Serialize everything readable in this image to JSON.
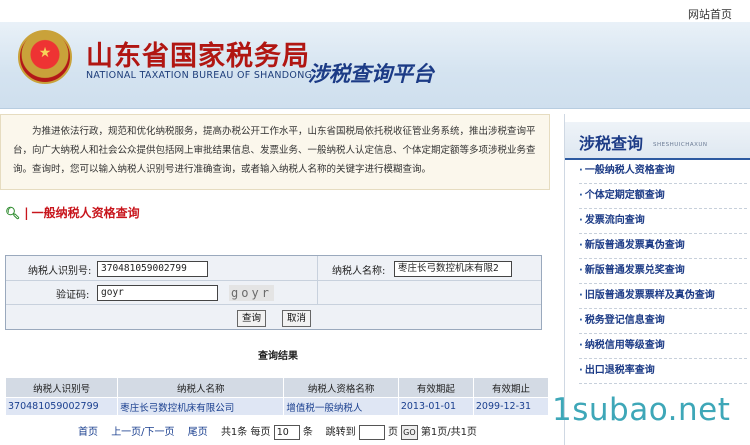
{
  "header": {
    "home_link": "网站首页",
    "title_cn": "山东省国家税务局",
    "title_en": "NATIONAL TAXATION BUREAU OF SHANDONG",
    "platform": "涉税查询平台"
  },
  "intro": {
    "text": "为推进依法行政，规范和优化纳税服务，提高办税公开工作水平，山东省国税局依托税收征管业务系统，推出涉税查询平台，向广大纳税人和社会公众提供包括网上审批结果信息、发票业务、一般纳税人认定信息、个体定期定额等多项涉税业务查询。查询时，您可以输入纳税人识别号进行准确查询，或者输入纳税人名称的关键字进行模糊查询。"
  },
  "section": {
    "title": "一般纳税人资格查询"
  },
  "form": {
    "taxpayer_id_label": "纳税人识别号:",
    "taxpayer_id_value": "370481059002799",
    "taxpayer_name_label": "纳税人名称:",
    "taxpayer_name_value": "枣庄长弓数控机床有限2",
    "captcha_label": "验证码:",
    "captcha_value": "goyr",
    "captcha_image_text": "goyr",
    "query_button": "查询",
    "cancel_button": "取消"
  },
  "results": {
    "title": "查询结果",
    "columns": [
      "纳税人识别号",
      "纳税人名称",
      "纳税人资格名称",
      "有效期起",
      "有效期止"
    ],
    "rows": [
      [
        "370481059002799",
        "枣庄长弓数控机床有限公司",
        "增值税一般纳税人",
        "2013-01-01",
        "2099-12-31"
      ]
    ]
  },
  "pager": {
    "first": "首页",
    "prev_next": "上一页/下一页",
    "last": "尾页",
    "total": "共1条",
    "per_page_label": "每页",
    "per_page_value": "10",
    "per_page_unit": "条",
    "goto_label": "跳转到",
    "goto_value": "",
    "goto_unit": "页",
    "go_button": "GO",
    "page_info": "第1页/共1页"
  },
  "sidebar": {
    "title": "涉税查询",
    "title_pinyin": "SHESHUICHAXUN",
    "items": [
      "一般纳税人资格查询",
      "个体定期定额查询",
      "发票流向查询",
      "新版普通发票真伪查询",
      "新版普通发票兑奖查询",
      "旧版普通发票票样及真伪查询",
      "税务登记信息查询",
      "纳税信用等级查询",
      "出口退税率查询"
    ]
  },
  "watermark": "1subao.net",
  "colors": {
    "title_red": "#b11612",
    "link_blue": "#1a3f8f",
    "watermark": "#3ea7b8"
  }
}
